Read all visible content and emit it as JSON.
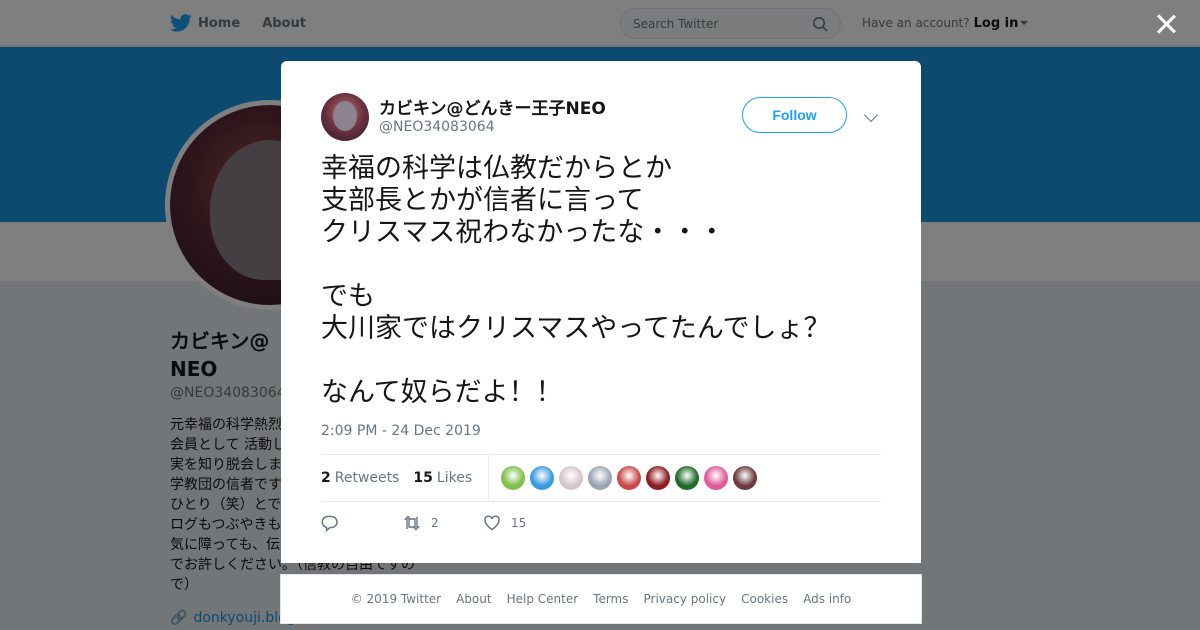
{
  "topbar": {
    "home_label": "Home",
    "about_label": "About",
    "search_placeholder": "Search Twitter",
    "account_prompt": "Have an account?",
    "login_label": "Log in"
  },
  "profile": {
    "name": "カビキン@\nNEO",
    "handle": "@NEO34083064",
    "bio": "元幸福の科学熱烈\n会員として 活動し\n実を知り脱会しま\n学教団の信者です\nひとり（笑）とで\nログもつぶやきも\n気に障っても、伝\nでお許しください。（信教の自由ですの\nで）",
    "link": "donkyouji.blog"
  },
  "tweet": {
    "author_name": "カビキン@どんきー王子NEO",
    "author_handle": "@NEO34083064",
    "follow_label": "Follow",
    "text": "幸福の科学は仏教だからとか\n支部長とかが信者に言って\nクリスマス祝わなかったな・・・\n\nでも\n大川家ではクリスマスやってたんでしょ？\n\nなんて奴らだよ！！",
    "timestamp": "2:09 PM - 24 Dec 2019",
    "retweets_count": "2",
    "retweets_label": "Retweets",
    "likes_count": "15",
    "likes_label": "Likes",
    "liker_colors": [
      "#7fbf4a",
      "#3a9be0",
      "#d7c6c9",
      "#9aa5b1",
      "#c94a4a",
      "#8b1e22",
      "#1e6b2a",
      "#e05a9a",
      "#6b3b3b"
    ],
    "actions": {
      "reply_count": "",
      "retweet_count": "2",
      "like_count": "15"
    }
  },
  "footer": {
    "links": [
      "© 2019 Twitter",
      "About",
      "Help Center",
      "Terms",
      "Privacy policy",
      "Cookies",
      "Ads info"
    ]
  },
  "colors": {
    "brand": "#1da1f2",
    "banner": "#1b95e0"
  }
}
